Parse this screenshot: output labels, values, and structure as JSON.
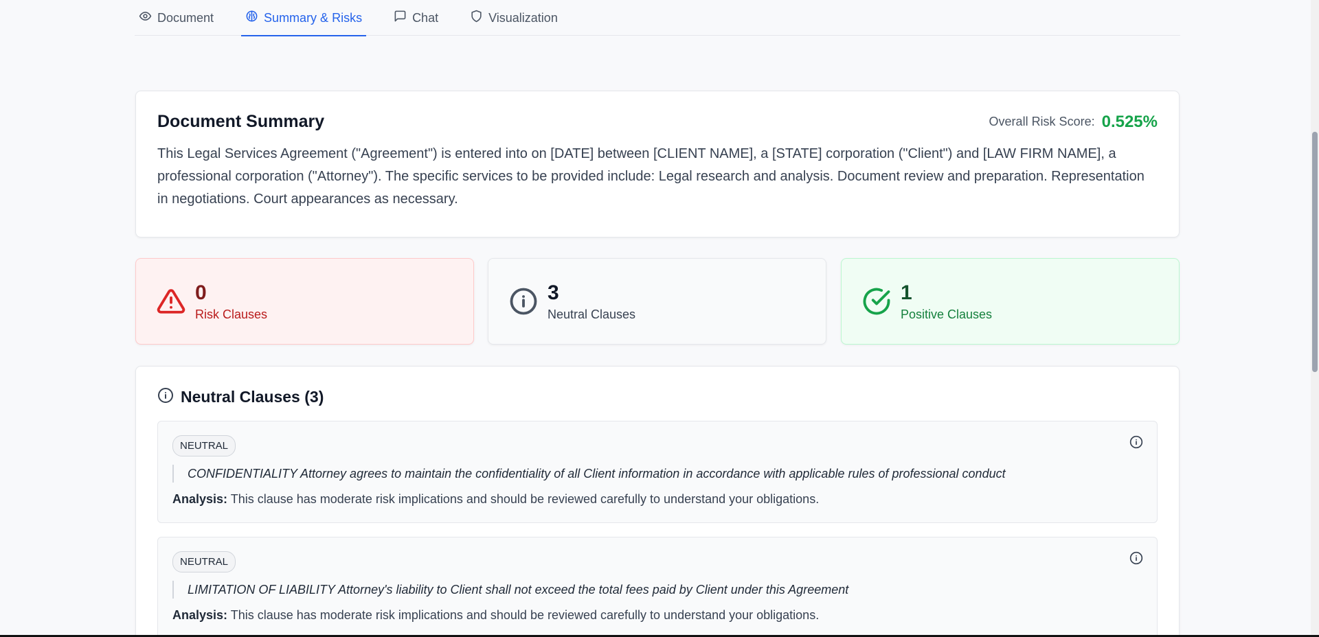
{
  "tabs": [
    {
      "label": "Document",
      "icon": "eye-icon",
      "active": false
    },
    {
      "label": "Summary & Risks",
      "icon": "brain-icon",
      "active": true
    },
    {
      "label": "Chat",
      "icon": "message-square-icon",
      "active": false
    },
    {
      "label": "Visualization",
      "icon": "shield-icon",
      "active": false
    }
  ],
  "summary": {
    "title": "Document Summary",
    "risk_score_label": "Overall Risk Score:",
    "risk_score_value": "0.525%",
    "text": "This Legal Services Agreement (\"Agreement\") is entered into on [DATE] between [CLIENT NAME], a [STATE] corporation (\"Client\") and [LAW FIRM NAME], a professional corporation (\"Attorney\"). The specific services to be provided include: Legal research and analysis. Document review and preparation. Representation in negotiations. Court appearances as necessary."
  },
  "stats": {
    "risk": {
      "count": "0",
      "label": "Risk Clauses",
      "icon": "alert-triangle-icon"
    },
    "neutral": {
      "count": "3",
      "label": "Neutral Clauses",
      "icon": "info-icon"
    },
    "positive": {
      "count": "1",
      "label": "Positive Clauses",
      "icon": "check-circle-icon"
    }
  },
  "neutral_section": {
    "title": "Neutral Clauses (3)",
    "clauses": [
      {
        "badge": "NEUTRAL",
        "text": "CONFIDENTIALITY Attorney agrees to maintain the confidentiality of all Client information in accordance with applicable rules of professional conduct",
        "analysis_label": "Analysis:",
        "analysis": "This clause has moderate risk implications and should be reviewed carefully to understand your obligations."
      },
      {
        "badge": "NEUTRAL",
        "text": "LIMITATION OF LIABILITY Attorney's liability to Client shall not exceed the total fees paid by Client under this Agreement",
        "analysis_label": "Analysis:",
        "analysis": "This clause has moderate risk implications and should be reviewed carefully to understand your obligations."
      }
    ]
  },
  "colors": {
    "accent": "#2563eb",
    "risk_score": "#16a34a",
    "risk": "#dc2626",
    "positive": "#16a34a"
  }
}
